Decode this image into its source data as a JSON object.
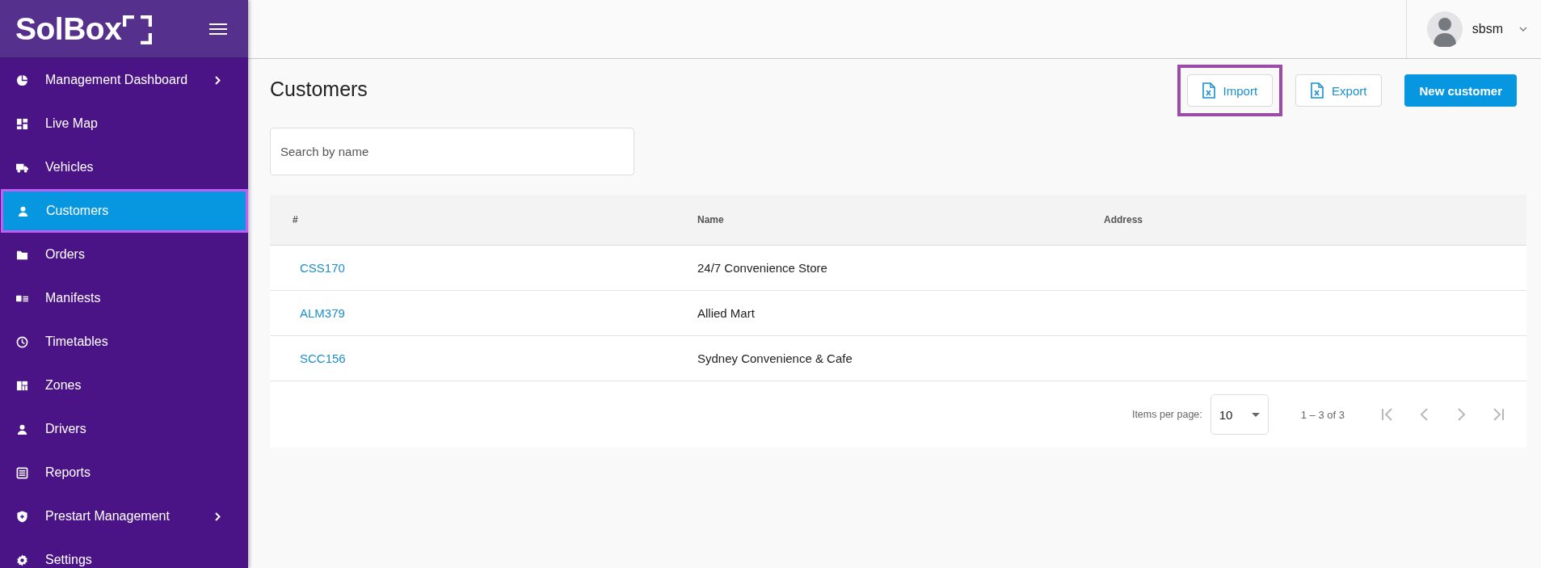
{
  "brand": {
    "logo": "SolBox"
  },
  "user": {
    "name": "sbsm"
  },
  "sidebar": {
    "items": [
      {
        "label": "Management Dashboard",
        "selected": false,
        "has_submenu": true,
        "highlighted": false
      },
      {
        "label": "Live Map",
        "selected": false,
        "has_submenu": false,
        "highlighted": false
      },
      {
        "label": "Vehicles",
        "selected": false,
        "has_submenu": false,
        "highlighted": false
      },
      {
        "label": "Customers",
        "selected": true,
        "has_submenu": false,
        "highlighted": true
      },
      {
        "label": "Orders",
        "selected": false,
        "has_submenu": false,
        "highlighted": false
      },
      {
        "label": "Manifests",
        "selected": false,
        "has_submenu": false,
        "highlighted": false
      },
      {
        "label": "Timetables",
        "selected": false,
        "has_submenu": false,
        "highlighted": false
      },
      {
        "label": "Zones",
        "selected": false,
        "has_submenu": false,
        "highlighted": false
      },
      {
        "label": "Drivers",
        "selected": false,
        "has_submenu": false,
        "highlighted": false
      },
      {
        "label": "Reports",
        "selected": false,
        "has_submenu": false,
        "highlighted": false
      },
      {
        "label": "Prestart Management",
        "selected": false,
        "has_submenu": true,
        "highlighted": false
      },
      {
        "label": "Settings",
        "selected": false,
        "has_submenu": false,
        "highlighted": false
      }
    ]
  },
  "page": {
    "title": "Customers",
    "actions": [
      {
        "label": "Import",
        "kind": "file",
        "highlighted": true
      },
      {
        "label": "Export",
        "kind": "file",
        "highlighted": false
      },
      {
        "label": "New customer",
        "kind": "primary",
        "highlighted": false
      }
    ]
  },
  "search": {
    "placeholder": "Search by name"
  },
  "table": {
    "columns": [
      "#",
      "Name",
      "Address"
    ],
    "rows": [
      {
        "id": "CSS170",
        "name": "24/7 Convenience Store"
      },
      {
        "id": "ALM379",
        "name": "Allied Mart"
      },
      {
        "id": "SCC156",
        "name": "Sydney Convenience & Cafe"
      }
    ]
  },
  "pagination": {
    "label": "Items per page:",
    "page_size": "10",
    "range": "1 – 3 of 3",
    "buttons": [
      {
        "kind": "first",
        "disabled": true
      },
      {
        "kind": "prev",
        "disabled": true
      },
      {
        "kind": "next",
        "disabled": true
      },
      {
        "kind": "last",
        "disabled": true
      }
    ]
  }
}
